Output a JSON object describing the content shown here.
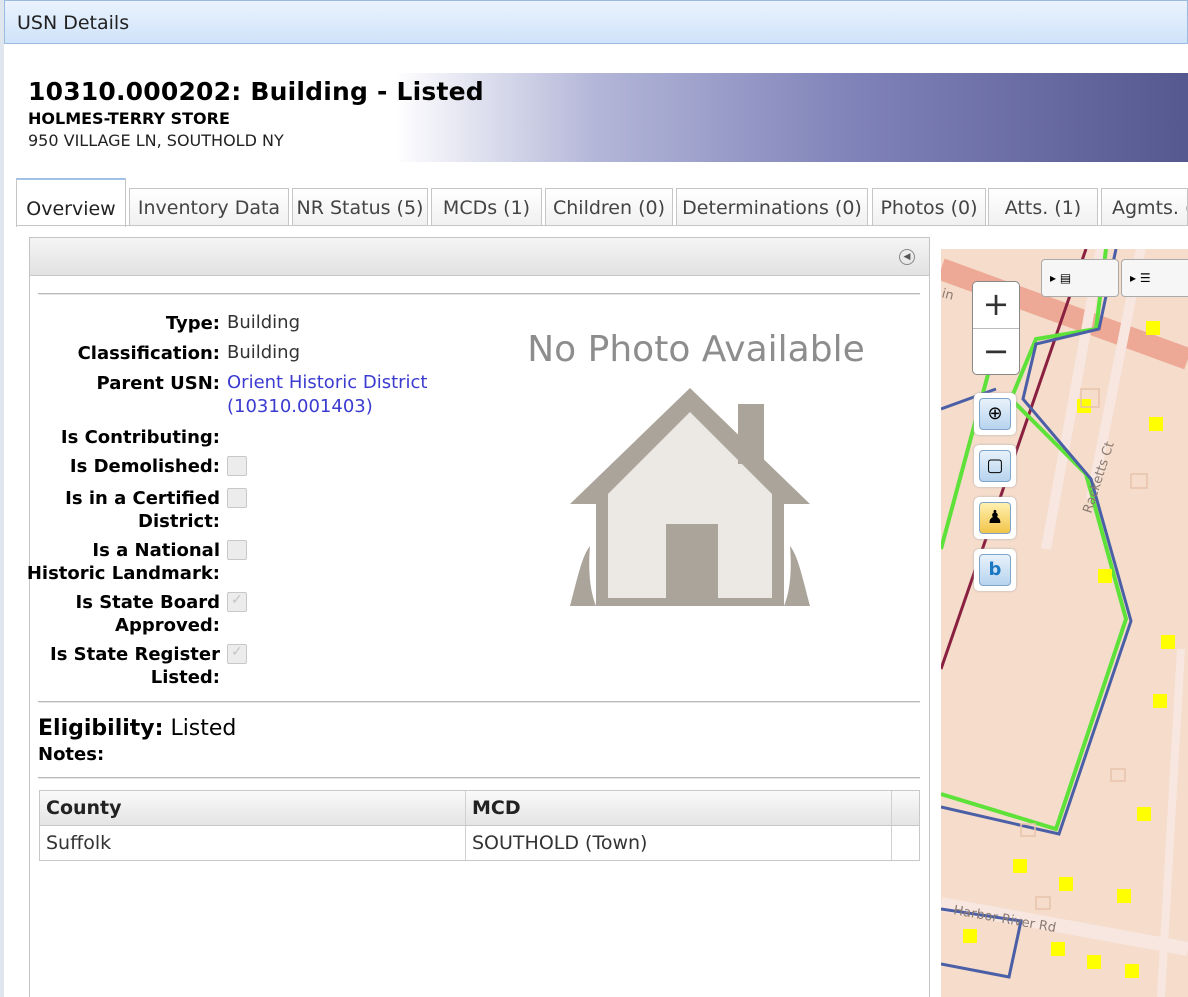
{
  "window": {
    "title": "USN Details"
  },
  "header": {
    "usn_line": "10310.000202:  Building  - Listed",
    "name": "HOLMES-TERRY STORE",
    "address": "950 VILLAGE LN, SOUTHOLD NY"
  },
  "tabs": [
    {
      "label": "Overview"
    },
    {
      "label": "Inventory Data"
    },
    {
      "label": "NR Status (5)"
    },
    {
      "label": "MCDs (1)"
    },
    {
      "label": "Children (0)"
    },
    {
      "label": "Determinations (0)"
    },
    {
      "label": "Photos (0)"
    },
    {
      "label": "Atts. (1)"
    },
    {
      "label": "Agmts. ("
    }
  ],
  "details": {
    "type_label": "Type:",
    "type_value": "Building",
    "class_label": "Classification:",
    "class_value": "Building",
    "parent_label": "Parent USN:",
    "parent_line1": "Orient Historic District",
    "parent_line2": "(10310.001403)",
    "contrib_label": "Is Contributing:",
    "demol_label": "Is Demolished:",
    "demol_checked": false,
    "cert_label_1": "Is in a Certified",
    "cert_label_2": "District:",
    "cert_checked": false,
    "nhl_label_1": "Is a National",
    "nhl_label_2": "Historic Landmark:",
    "nhl_checked": false,
    "sba_label_1": "Is State Board",
    "sba_label_2": "Approved:",
    "sba_checked": true,
    "srl_label_1": "Is State Register",
    "srl_label_2": "Listed:",
    "srl_checked": true
  },
  "photo": {
    "placeholder": "No Photo Available"
  },
  "eligibility": {
    "label": "Eligibility:",
    "value": "Listed",
    "notes_label": "Notes:"
  },
  "mcd_table": {
    "columns": [
      "County",
      "MCD"
    ],
    "rows": [
      [
        "Suffolk",
        "SOUTHOLD (Town)"
      ]
    ]
  },
  "map": {
    "zoom_in": "+",
    "zoom_out": "−",
    "street_labels": [
      "Racketts Ct",
      "Harbor River Rd",
      "in"
    ]
  },
  "colors": {
    "header_gradient_end": "#55588f",
    "link": "#3b3bd0",
    "map_parcel": "#f5dccb",
    "map_marker": "#ffff00",
    "boundary_green": "#5ee23a",
    "boundary_blue": "#4a5fa6",
    "road_salmon": "#eea996"
  }
}
